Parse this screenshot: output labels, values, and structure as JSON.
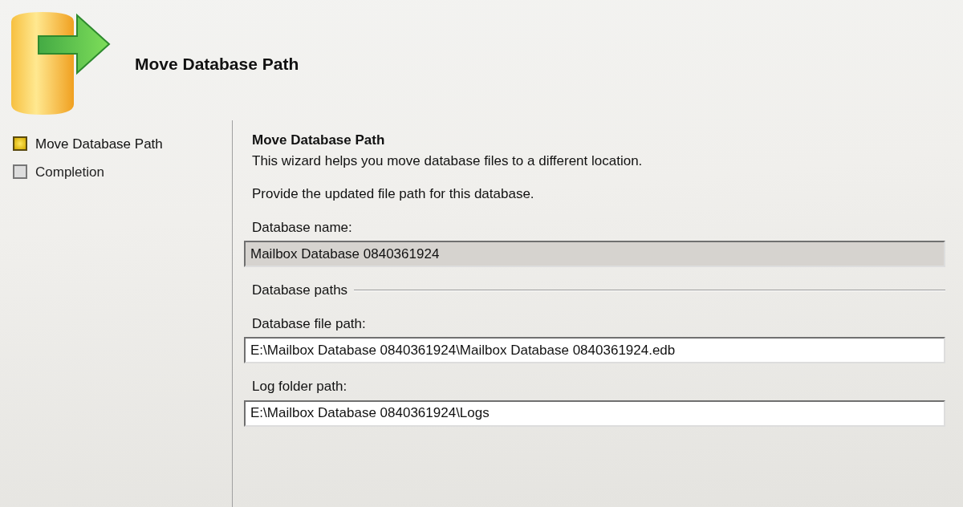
{
  "header": {
    "title": "Move Database Path"
  },
  "steps": [
    {
      "label": "Move Database Path",
      "selected": true
    },
    {
      "label": "Completion",
      "selected": false
    }
  ],
  "page": {
    "heading": "Move Database Path",
    "intro": "This wizard helps you move database files to a different location.",
    "instruction": "Provide the updated file path for this database.",
    "name_field": {
      "label": "Database name:",
      "value": "Mailbox Database 0840361924",
      "disabled": true
    },
    "group_label": "Database paths",
    "path_fields": [
      {
        "label": "Database file path:",
        "value": "E:\\Mailbox Database 0840361924\\Mailbox Database 0840361924.edb",
        "disabled": false
      },
      {
        "label": "Log folder path:",
        "value": "E:\\Mailbox Database 0840361924\\Logs",
        "disabled": false
      }
    ]
  }
}
